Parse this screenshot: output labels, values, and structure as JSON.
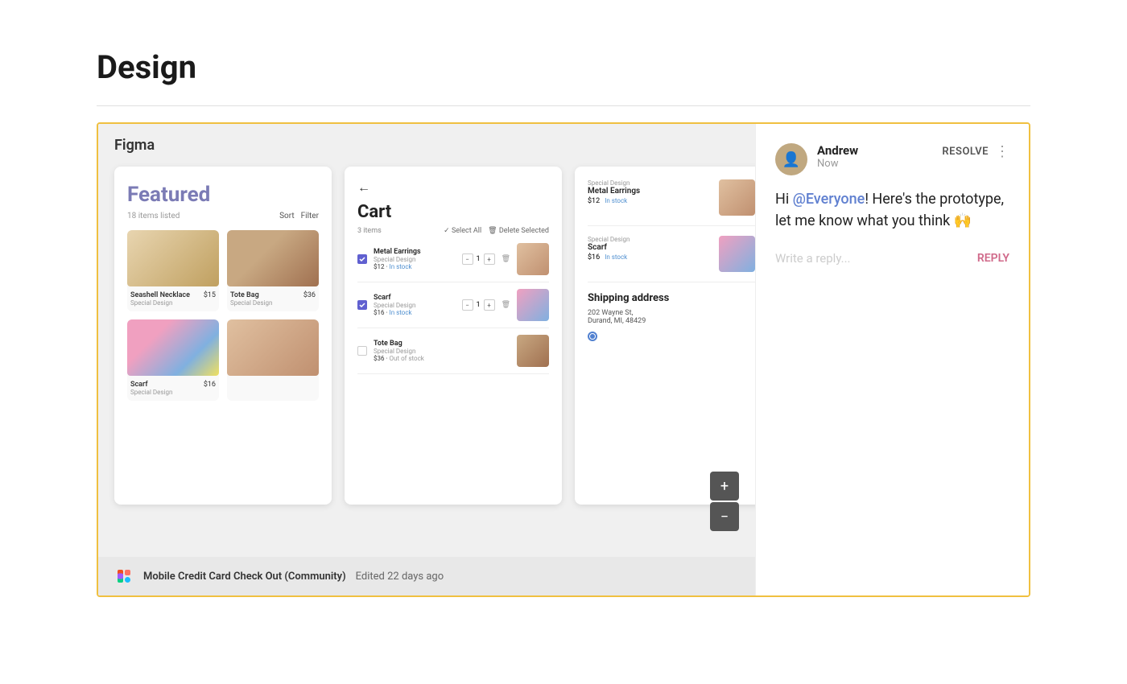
{
  "page": {
    "title": "Design"
  },
  "figma": {
    "header_title": "Figma",
    "footer": {
      "file_name": "Mobile Credit Card Check Out (Community)",
      "edit_time": "Edited 22 days ago"
    }
  },
  "featured_screen": {
    "title": "Featured",
    "items_count": "18 items listed",
    "sort_label": "Sort",
    "filter_label": "Filter",
    "products": [
      {
        "name": "Seashell Necklace",
        "price": "$15",
        "tag": "Special Design",
        "img_class": "necklace"
      },
      {
        "name": "Tote Bag",
        "price": "$36",
        "tag": "Special Design",
        "img_class": "tote"
      },
      {
        "name": "Scarf",
        "price": "$16",
        "tag": "Special Design",
        "img_class": "scarf"
      },
      {
        "name": "",
        "price": "",
        "tag": "",
        "img_class": "earrings"
      }
    ]
  },
  "cart_screen": {
    "back_icon": "←",
    "title": "Cart",
    "items_count": "3 items",
    "select_all": "✓ Select All",
    "delete_selected": "🗑 Delete Selected",
    "items": [
      {
        "name": "Metal Earrings",
        "tag": "Special Design",
        "price": "$12",
        "stock": "In stock",
        "checked": true,
        "img_class": "earrings-img"
      },
      {
        "name": "Scarf",
        "tag": "Special Design",
        "price": "$16",
        "stock": "In stock",
        "checked": true,
        "img_class": "scarf-img"
      },
      {
        "name": "Tote Bag",
        "tag": "Special Design",
        "price": "$36",
        "stock": "Out of stock",
        "checked": false,
        "img_class": "tote-img"
      }
    ]
  },
  "right_partial": {
    "items": [
      {
        "name": "Metal Earrings",
        "tag": "Special Design",
        "price": "$12",
        "stock": "In stock",
        "img_class": "earrings-img"
      },
      {
        "name": "Scarf",
        "tag": "Special Design",
        "price": "$16",
        "stock": "In stock",
        "img_class": "scarf-img"
      }
    ],
    "shipping": {
      "title": "Shipping address",
      "address_line1": "202 Wayne St,",
      "address_line2": "Durand, MI, 48429"
    }
  },
  "zoom_controls": {
    "plus": "+",
    "minus": "−"
  },
  "comment": {
    "author": "Andrew",
    "time": "Now",
    "resolve_label": "RESOLVE",
    "more_label": "⋮",
    "body_pre": "Hi ",
    "mention": "@Everyone",
    "body_post": "! Here's the prototype, let me know what you think 🙌",
    "reply_placeholder": "Write a reply...",
    "reply_button": "REPLY"
  }
}
